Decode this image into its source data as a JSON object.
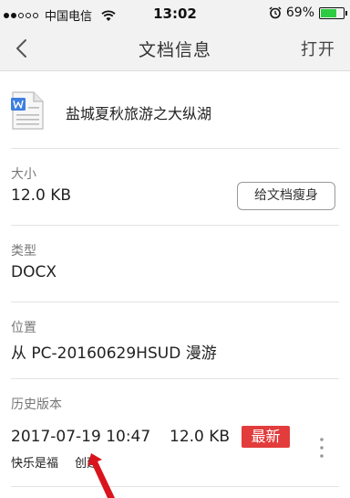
{
  "status_bar": {
    "carrier": "中国电信",
    "time": "13:02",
    "battery_text": "69%",
    "battery_level": 0.69,
    "icons": [
      "signal-dots-icon",
      "wifi-icon",
      "alarm-icon",
      "battery-icon"
    ]
  },
  "nav": {
    "back_icon": "chevron-left-icon",
    "title": "文档信息",
    "open_label": "打开"
  },
  "file": {
    "icon": "word-document-icon",
    "name": "盐城夏秋旅游之大纵湖"
  },
  "size": {
    "label": "大小",
    "value": "12.0 KB",
    "slim_button_label": "给文档瘦身"
  },
  "type": {
    "label": "类型",
    "value": "DOCX"
  },
  "location": {
    "label": "位置",
    "value": "从 PC-20160629HSUD 漫游"
  },
  "history": {
    "label": "历史版本",
    "versions": [
      {
        "datetime": "2017-07-19 10:47",
        "size": "12.0 KB",
        "badge": "最新",
        "author": "快乐是福",
        "action": "创建",
        "more_icon": "more-vertical-icon"
      }
    ]
  },
  "colors": {
    "accent_red": "#e23c3c",
    "bar_background": "#f2f2f2",
    "battery_green": "#2ecc40"
  }
}
